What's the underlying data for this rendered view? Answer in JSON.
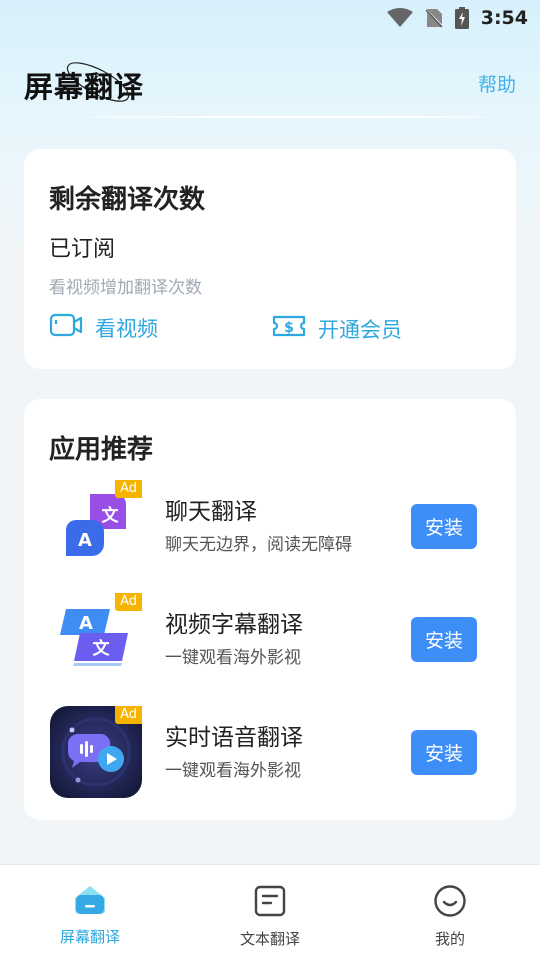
{
  "status_bar": {
    "time": "3:54"
  },
  "header": {
    "title": "屏幕翻译",
    "help": "帮助"
  },
  "quota_card": {
    "title": "剩余翻译次数",
    "status": "已订阅",
    "hint": "看视频增加翻译次数",
    "watch_video": "看视频",
    "open_vip": "开通会员"
  },
  "recommend": {
    "title": "应用推荐",
    "apps": [
      {
        "name": "聊天翻译",
        "desc": "聊天无边界，阅读无障碍",
        "ad": "Ad",
        "install": "安装",
        "icon": "chat-translate-icon"
      },
      {
        "name": "视频字幕翻译",
        "desc": "一键观看海外影视",
        "ad": "Ad",
        "install": "安装",
        "icon": "subtitle-translate-icon"
      },
      {
        "name": "实时语音翻译",
        "desc": "一键观看海外影视",
        "ad": "Ad",
        "install": "安装",
        "icon": "voice-translate-icon"
      }
    ]
  },
  "bottom_nav": [
    {
      "label": "屏幕翻译",
      "active": true,
      "icon": "home-icon"
    },
    {
      "label": "文本翻译",
      "active": false,
      "icon": "document-icon"
    },
    {
      "label": "我的",
      "active": false,
      "icon": "profile-icon"
    }
  ],
  "colors": {
    "accent": "#2ea8e0",
    "install_button": "#3e8ef7",
    "ad_badge": "#f6b400"
  }
}
